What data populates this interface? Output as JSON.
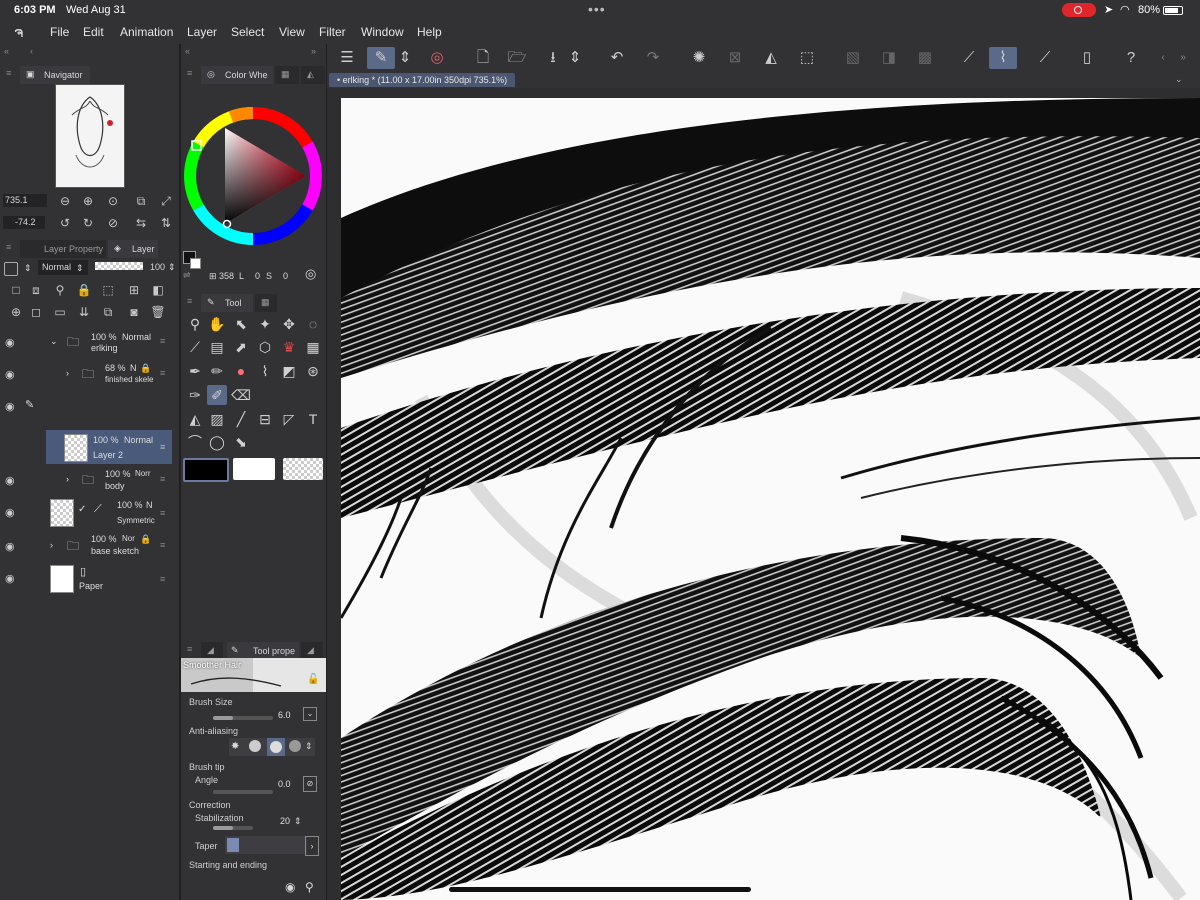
{
  "status_bar": {
    "time": "6:03 PM",
    "date": "Wed Aug 31",
    "battery": "80%"
  },
  "menu": {
    "items": [
      "File",
      "Edit",
      "Animation",
      "Layer",
      "Select",
      "View",
      "Filter",
      "Window",
      "Help"
    ]
  },
  "navigator": {
    "title": "Navigator",
    "zoom": "735.1",
    "rotation": "-74.2"
  },
  "color_wheel": {
    "title": "Color Whe",
    "size_label": "358",
    "size_unit": "L",
    "s_value": "0",
    "s_label": "S",
    "b_value": "0"
  },
  "layer_panel": {
    "tab_property": "Layer Property",
    "tab_layer": "Layer",
    "blend_mode": "Normal",
    "opacity": "100",
    "layers": [
      {
        "opacity": "100 %",
        "mode": "Normal",
        "name": "erlking"
      },
      {
        "opacity": "68 %",
        "mode": "N",
        "name": "finished skele"
      },
      {
        "opacity": "100 %",
        "mode": "Normal",
        "name": "Layer 2"
      },
      {
        "opacity": "100 %",
        "mode": "Norr",
        "name": "body"
      },
      {
        "opacity": "100 %",
        "mode": "N",
        "name": "Symmetric"
      },
      {
        "opacity": "100 %",
        "mode": "Nor",
        "name": "base sketch"
      },
      {
        "opacity": "",
        "mode": "",
        "name": "Paper"
      }
    ]
  },
  "tool_panel": {
    "title": "Tool"
  },
  "tool_property": {
    "title": "Tool prope",
    "brush_name": "Smoother Hair",
    "brush_size_label": "Brush Size",
    "brush_size": "6.0",
    "anti_aliasing_label": "Anti-aliasing",
    "brush_tip_label": "Brush tip",
    "angle_label": "Angle",
    "angle": "0.0",
    "correction_label": "Correction",
    "stabilization_label": "Stabilization",
    "stabilization": "20",
    "taper_label": "Taper",
    "starting_ending_label": "Starting and ending"
  },
  "document": {
    "tab_title": "erlking * (11.00 x 17.00in 350dpi 735.1%)"
  },
  "colors": {
    "accent": "#5a6a88",
    "panel": "#323235",
    "record": "#e0262b",
    "selection": "#4a5a7a"
  }
}
